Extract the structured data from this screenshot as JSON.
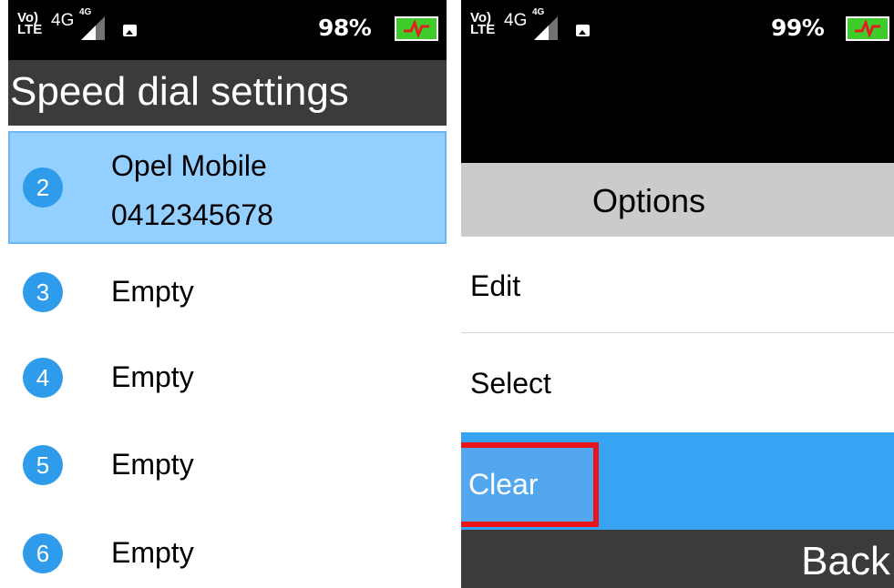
{
  "left_screen": {
    "status": {
      "volte": "Vo)",
      "lte": "LTE",
      "network": "4G",
      "sim_network": "4G",
      "battery_percent": "98%"
    },
    "title": "Speed dial settings",
    "items": [
      {
        "number": "2",
        "name": "Opel Mobile",
        "phone": "0412345678",
        "selected": true
      },
      {
        "number": "3",
        "name": "Empty"
      },
      {
        "number": "4",
        "name": "Empty"
      },
      {
        "number": "5",
        "name": "Empty"
      },
      {
        "number": "6",
        "name": "Empty"
      }
    ]
  },
  "right_screen": {
    "status": {
      "volte": "Vo)",
      "lte": "LTE",
      "network": "4G",
      "sim_network": "4G",
      "battery_percent": "99%"
    },
    "options_title": "Options",
    "menu": [
      {
        "label": "Edit"
      },
      {
        "label": "Select"
      },
      {
        "label": "Clear",
        "selected": true
      }
    ],
    "softkey_right": "Back"
  },
  "colors": {
    "selected_item_bg": "#93cfff",
    "number_circle": "#2f9ceb",
    "menu_selected_bg": "#38a3f2",
    "annotation_box": "#e8151b",
    "battery_fill": "#3fcc2a"
  },
  "icons": [
    "volte-icon",
    "signal-icon",
    "gallery-icon",
    "battery-charging-icon"
  ]
}
